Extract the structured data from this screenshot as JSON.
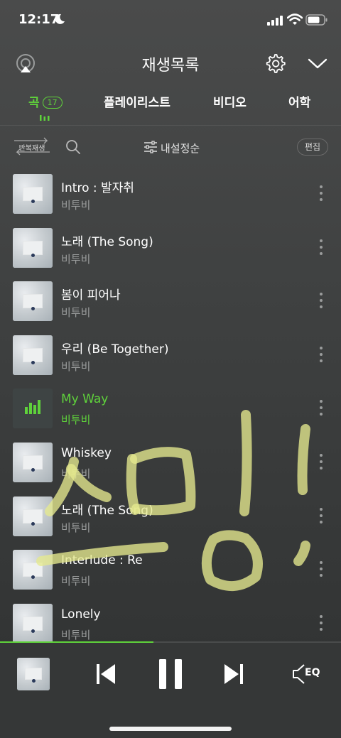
{
  "status": {
    "time": "12:17"
  },
  "header": {
    "title": "재생목록"
  },
  "tabs": [
    {
      "label": "곡",
      "count": "17",
      "active": true
    },
    {
      "label": "플레이리스트"
    },
    {
      "label": "비디오"
    },
    {
      "label": "어학"
    }
  ],
  "toolbar": {
    "repeat_label": "반복재생",
    "sort_label": "내설정순",
    "edit_label": "편집"
  },
  "songs": [
    {
      "title": "Intro : 발자취",
      "artist": "비투비"
    },
    {
      "title": "노래 (The Song)",
      "artist": "비투비"
    },
    {
      "title": "봄이 피어나",
      "artist": "비투비"
    },
    {
      "title": "우리 (Be Together)",
      "artist": "비투비"
    },
    {
      "title": "My Way",
      "artist": "비투비",
      "playing": true
    },
    {
      "title": "Whiskey",
      "artist": "비투비"
    },
    {
      "title": "노래 (The Song)",
      "artist": "비투비"
    },
    {
      "title": "Interlude : Re",
      "artist": "비투비"
    },
    {
      "title": "Lonely",
      "artist": "비투비"
    }
  ],
  "player": {
    "progress": 0.45,
    "eq_label": "EQ"
  },
  "colors": {
    "accent": "#5fd33b",
    "background": "#3f4141",
    "muted_text": "#9a9c9c",
    "scribble": "#e6e98e"
  }
}
